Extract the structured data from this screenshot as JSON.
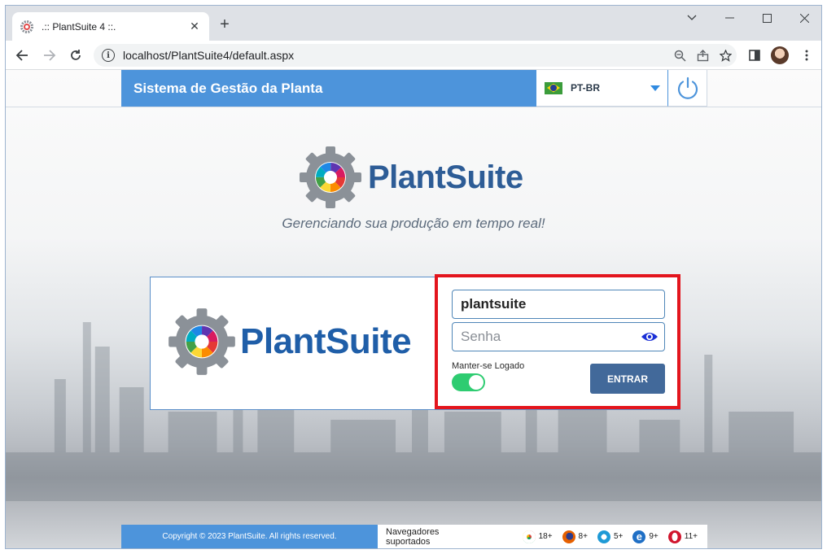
{
  "browser": {
    "tab_title": ".:: PlantSuite 4 ::.",
    "url": "localhost/PlantSuite4/default.aspx"
  },
  "header": {
    "title": "Sistema de Gestão da Planta",
    "language": "PT-BR"
  },
  "brand": {
    "name": "PlantSuite",
    "tagline": "Gerenciando sua produção em tempo real!"
  },
  "login": {
    "username": "plantsuite",
    "password_placeholder": "Senha",
    "keep_logged_label": "Manter-se Logado",
    "keep_logged": true,
    "submit_label": "ENTRAR"
  },
  "footer": {
    "copyright": "Copyright © 2023 PlantSuite. All rights reserved.",
    "supported_label": "Navegadores suportados",
    "browsers": [
      {
        "name": "chrome",
        "version": "18+",
        "color": "#db4437"
      },
      {
        "name": "firefox",
        "version": "8+",
        "color": "#e66000"
      },
      {
        "name": "safari",
        "version": "5+",
        "color": "#1e9ad6"
      },
      {
        "name": "ie",
        "version": "9+",
        "color": "#1f6fc5"
      },
      {
        "name": "opera",
        "version": "11+",
        "color": "#d1162e"
      }
    ]
  },
  "colors": {
    "accent": "#4d94db",
    "button": "#42699a",
    "highlight": "#e3151d",
    "toggle_on": "#2ecc71"
  }
}
